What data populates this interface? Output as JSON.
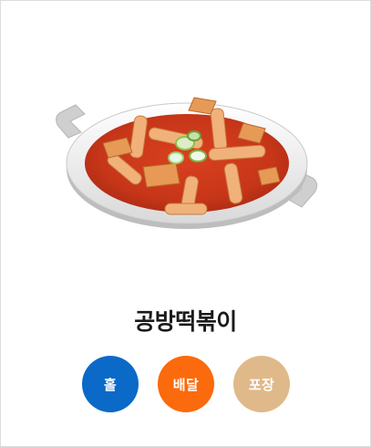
{
  "product": {
    "name": "공방떡볶이"
  },
  "options": [
    {
      "label": "홀",
      "color": "#0b69c7"
    },
    {
      "label": "배달",
      "color": "#fb6a0c"
    },
    {
      "label": "포장",
      "color": "#e0b98a"
    }
  ],
  "image": {
    "icon": "tteokbokki-dish-image"
  }
}
